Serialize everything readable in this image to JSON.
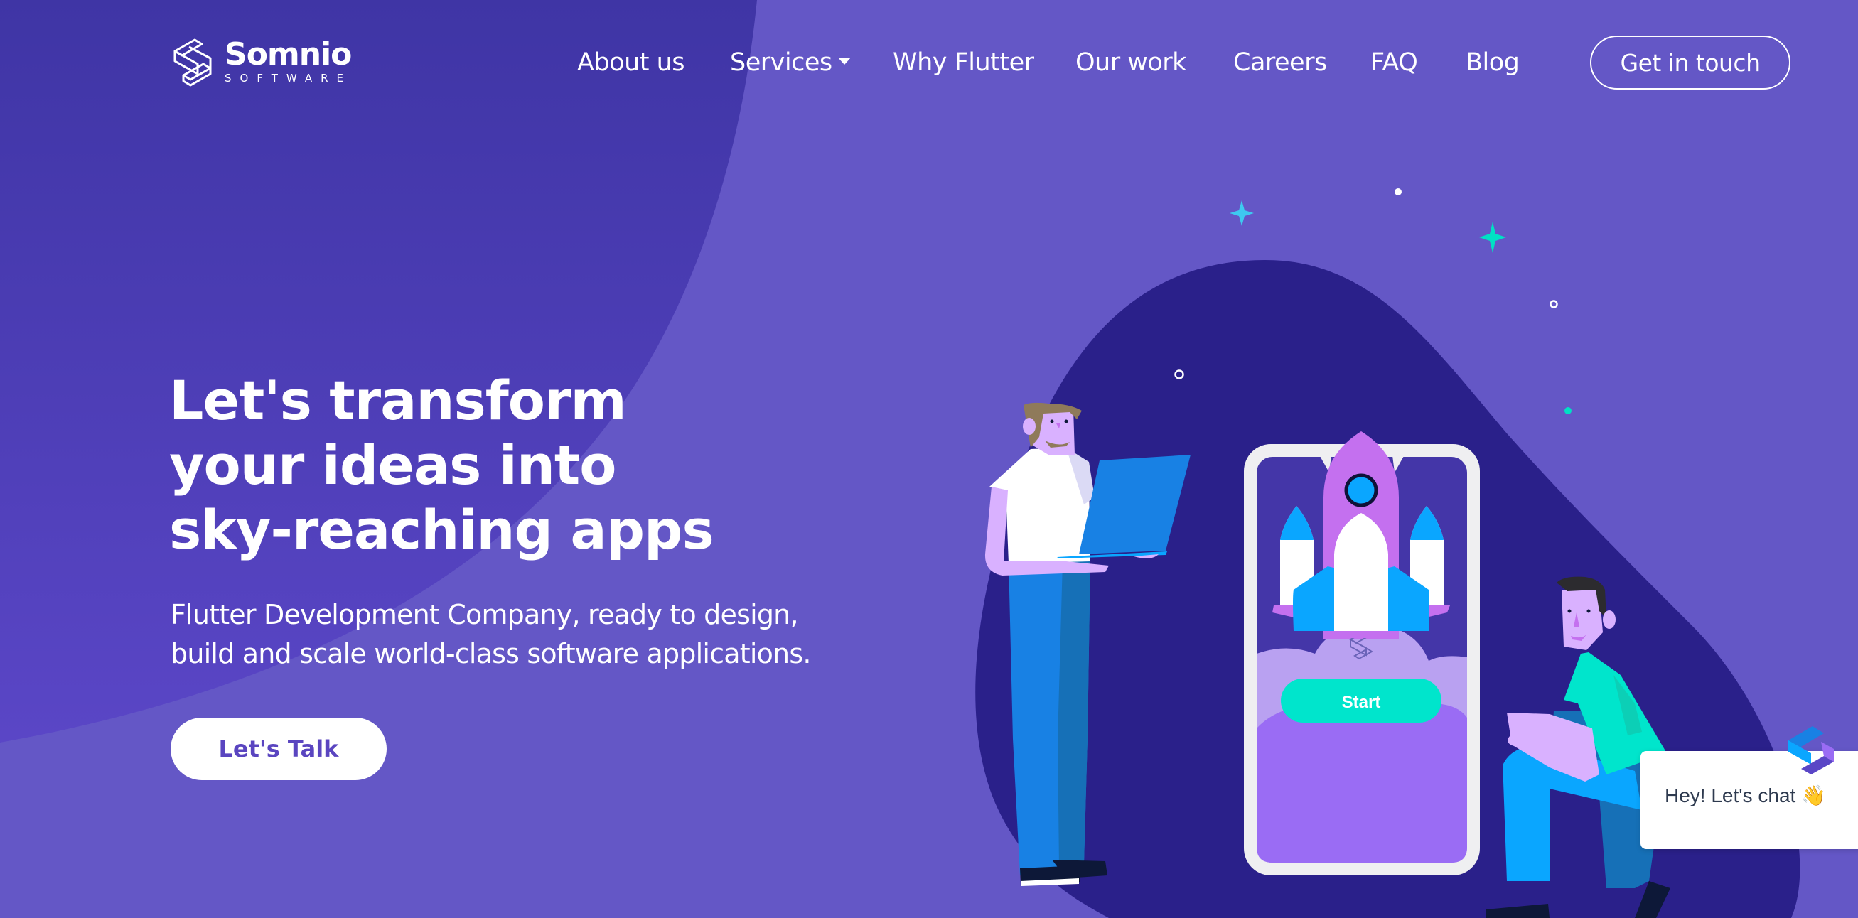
{
  "brand": {
    "name": "Somnio",
    "subname": "SOFTWARE",
    "colors": {
      "background": "#6457c6",
      "background_dark_curve": "#4236a8",
      "blob": "#2a208a",
      "accent_teal": "#00e5cc",
      "accent_blue": "#0aa6ff",
      "accent_purple": "#c470ef",
      "cta_text": "#5a45c0"
    }
  },
  "nav": {
    "items": [
      {
        "label": "About us",
        "has_dropdown": false
      },
      {
        "label": "Services",
        "has_dropdown": true
      },
      {
        "label": "Why Flutter",
        "has_dropdown": false
      },
      {
        "label": "Our work",
        "has_dropdown": false
      },
      {
        "label": "Careers",
        "has_dropdown": false
      },
      {
        "label": "FAQ",
        "has_dropdown": false
      },
      {
        "label": "Blog",
        "has_dropdown": false
      }
    ],
    "cta_label": "Get in touch"
  },
  "hero": {
    "headline_lines": [
      "Let's transform",
      "your ideas into",
      "sky-reaching apps"
    ],
    "subtitle_lines": [
      "Flutter Development Company, ready to design,",
      "build and scale world-class software applications."
    ],
    "cta_label": "Let's Talk"
  },
  "illustration": {
    "phone_button_label": "Start"
  },
  "chat_widget": {
    "text": "Hey! Let's chat 👋"
  }
}
